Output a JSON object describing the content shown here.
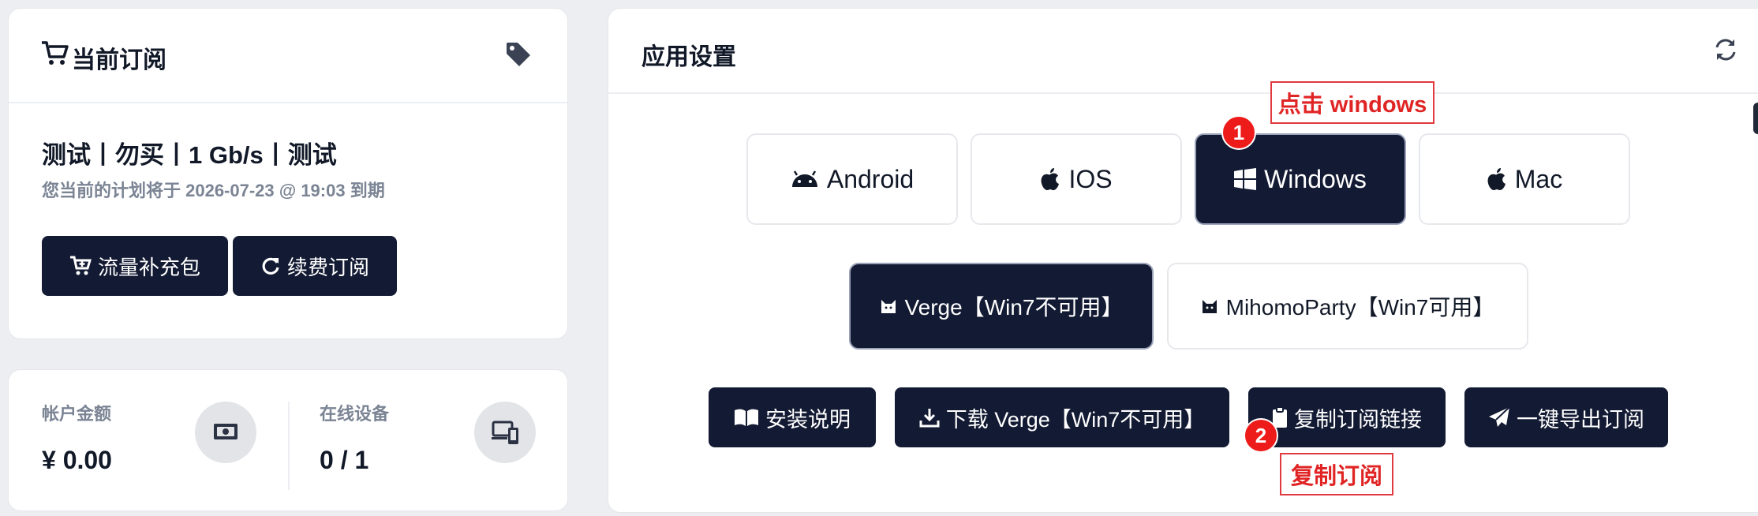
{
  "subscription": {
    "title": "当前订阅",
    "plan_name": "测试丨勿买丨1 Gb/s丨测试",
    "expiry_text": "您当前的计划将于 2026-07-23 @ 19:03 到期",
    "traffic_button": "流量补充包",
    "renew_button": "续费订阅",
    "icons": {
      "title": "cart-icon",
      "tag": "tag-icon",
      "traffic": "cart-plus-icon",
      "renew": "refresh-icon"
    }
  },
  "stats": {
    "balance_label": "帐户金额",
    "balance_value": "¥ 0.00",
    "devices_label": "在线设备",
    "devices_value": "0 / 1",
    "icons": {
      "balance": "money-icon",
      "devices": "devices-icon"
    }
  },
  "app_settings": {
    "title": "应用设置",
    "sync_icon": "sync-icon",
    "platforms": [
      {
        "label": "Android",
        "icon": "android-icon",
        "active": false
      },
      {
        "label": "IOS",
        "icon": "apple-icon",
        "active": false
      },
      {
        "label": "Windows",
        "icon": "windows-icon",
        "active": true
      },
      {
        "label": "Mac",
        "icon": "apple-icon",
        "active": false
      }
    ],
    "clients": [
      {
        "label": "Verge【Win7不可用】",
        "icon": "cat-icon",
        "active": true
      },
      {
        "label": "MihomoParty【Win7可用】",
        "icon": "cat-icon",
        "active": false
      }
    ],
    "actions": [
      {
        "label": "安装说明",
        "icon": "book-icon"
      },
      {
        "label": "下载 Verge【Win7不可用】",
        "icon": "download-icon"
      },
      {
        "label": "复制订阅链接",
        "icon": "clipboard-icon"
      },
      {
        "label": "一键导出订阅",
        "icon": "send-icon"
      }
    ]
  },
  "annotations": [
    {
      "number": "1",
      "text": "点击 windows"
    },
    {
      "number": "2",
      "text": "复制订阅"
    }
  ],
  "colors": {
    "dark_button": "#131a33",
    "annotation_red": "#e02424",
    "muted_text": "#7b8494",
    "background": "#eceef2"
  }
}
